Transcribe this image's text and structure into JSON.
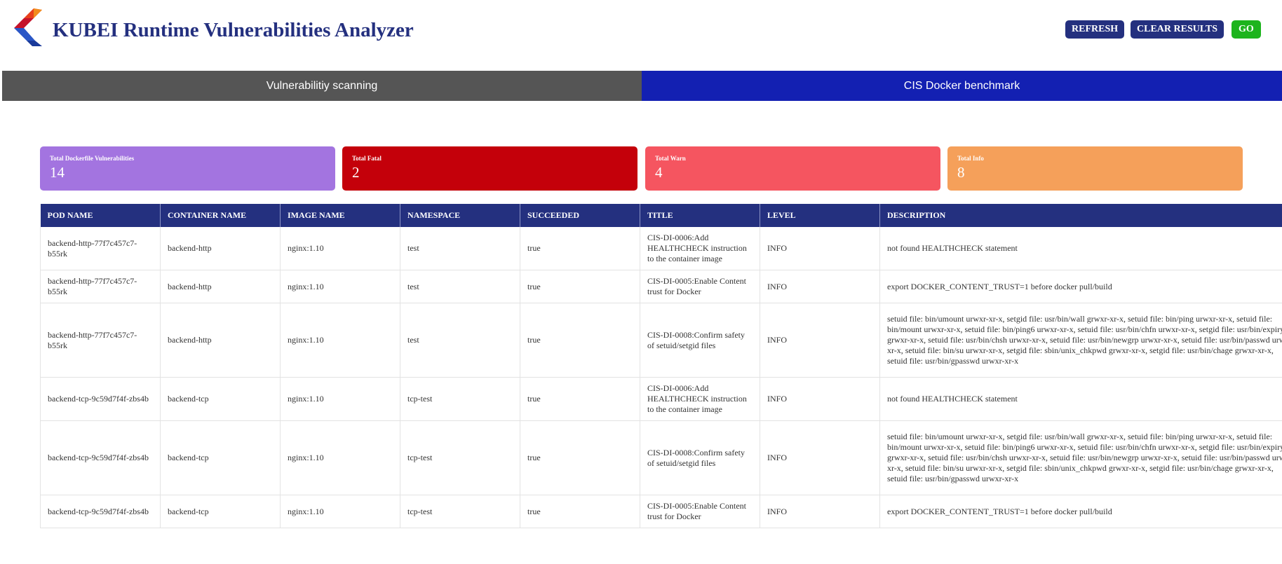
{
  "app": {
    "title": "KUBEI Runtime Vulnerabilities Analyzer",
    "logo_icon": "kubei-logo-icon"
  },
  "toolbar": {
    "refresh_label": "REFRESH",
    "clear_label": "CLEAR RESULTS",
    "go_label": "GO"
  },
  "tabs": [
    {
      "label": "Vulnerabilitiy scanning"
    },
    {
      "label": "CIS Docker benchmark"
    }
  ],
  "cards": [
    {
      "label": "Total Dockerfile Vulnerabilities",
      "value": "14",
      "color": "#a374e0"
    },
    {
      "label": "Total Fatal",
      "value": "2",
      "color": "#c4000a"
    },
    {
      "label": "Total Warn",
      "value": "4",
      "color": "#f55560"
    },
    {
      "label": "Total Info",
      "value": "8",
      "color": "#f5a05a"
    }
  ],
  "table": {
    "headers": [
      "POD NAME",
      "CONTAINER NAME",
      "IMAGE NAME",
      "NAMESPACE",
      "SUCCEEDED",
      "TITLE",
      "LEVEL",
      "DESCRIPTION"
    ],
    "rows": [
      [
        "backend-http-77f7c457c7-b55rk",
        "backend-http",
        "nginx:1.10",
        "test",
        "true",
        "CIS-DI-0006:Add HEALTHCHECK instruction to the container image",
        "INFO",
        "not found HEALTHCHECK statement"
      ],
      [
        "backend-http-77f7c457c7-b55rk",
        "backend-http",
        "nginx:1.10",
        "test",
        "true",
        "CIS-DI-0005:Enable Content trust for Docker",
        "INFO",
        "export DOCKER_CONTENT_TRUST=1 before docker pull/build"
      ],
      [
        "backend-http-77f7c457c7-b55rk",
        "backend-http",
        "nginx:1.10",
        "test",
        "true",
        "CIS-DI-0008:Confirm safety of setuid/setgid files",
        "INFO",
        "setuid file: bin/umount urwxr-xr-x, setgid file: usr/bin/wall grwxr-xr-x, setuid file: bin/ping urwxr-xr-x, setuid file: bin/mount urwxr-xr-x, setuid file: bin/ping6 urwxr-xr-x, setuid file: usr/bin/chfn urwxr-xr-x, setgid file: usr/bin/expiry grwxr-xr-x, setuid file: usr/bin/chsh urwxr-xr-x, setuid file: usr/bin/newgrp urwxr-xr-x, setuid file: usr/bin/passwd urwxr-xr-x, setuid file: bin/su urwxr-xr-x, setgid file: sbin/unix_chkpwd grwxr-xr-x, setgid file: usr/bin/chage grwxr-xr-x, setuid file: usr/bin/gpasswd urwxr-xr-x"
      ],
      [
        "backend-tcp-9c59d7f4f-zbs4b",
        "backend-tcp",
        "nginx:1.10",
        "tcp-test",
        "true",
        "CIS-DI-0006:Add HEALTHCHECK instruction to the container image",
        "INFO",
        "not found HEALTHCHECK statement"
      ],
      [
        "backend-tcp-9c59d7f4f-zbs4b",
        "backend-tcp",
        "nginx:1.10",
        "tcp-test",
        "true",
        "CIS-DI-0008:Confirm safety of setuid/setgid files",
        "INFO",
        "setuid file: bin/umount urwxr-xr-x, setgid file: usr/bin/wall grwxr-xr-x, setuid file: bin/ping urwxr-xr-x, setuid file: bin/mount urwxr-xr-x, setuid file: bin/ping6 urwxr-xr-x, setuid file: usr/bin/chfn urwxr-xr-x, setgid file: usr/bin/expiry grwxr-xr-x, setuid file: usr/bin/chsh urwxr-xr-x, setuid file: usr/bin/newgrp urwxr-xr-x, setuid file: usr/bin/passwd urwxr-xr-x, setuid file: bin/su urwxr-xr-x, setgid file: sbin/unix_chkpwd grwxr-xr-x, setgid file: usr/bin/chage grwxr-xr-x, setuid file: usr/bin/gpasswd urwxr-xr-x"
      ],
      [
        "backend-tcp-9c59d7f4f-zbs4b",
        "backend-tcp",
        "nginx:1.10",
        "tcp-test",
        "true",
        "CIS-DI-0005:Enable Content trust for Docker",
        "INFO",
        "export DOCKER_CONTENT_TRUST=1 before docker pull/build"
      ]
    ]
  }
}
